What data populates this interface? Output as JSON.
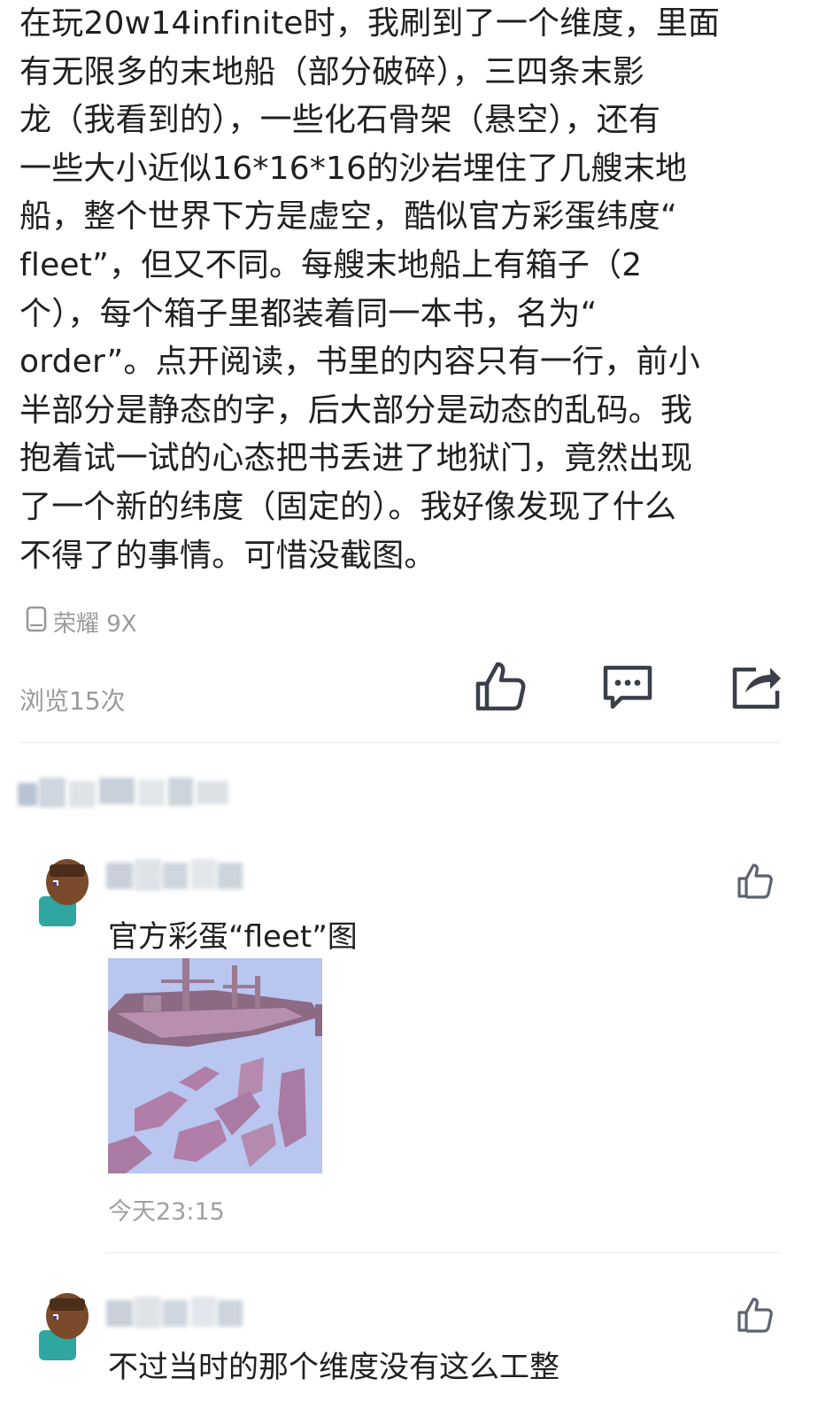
{
  "post": {
    "body": "在玩20w14infinite时，我刷到了一个维度，里面\n有无限多的末地船（部分破碎），三四条末影\n龙（我看到的），一些化石骨架（悬空），还有\n一些大小近似16*16*16的沙岩埋住了几艘末地\n船，整个世界下方是虚空，酷似官方彩蛋纬度“\nfleet”，但又不同。每艘末地船上有箱子（2\n个），每个箱子里都装着同一本书，名为“\norder”。点开阅读，书里的内容只有一行，前小\n半部分是静态的字，后大部分是动态的乱码。我\n抱着试一试的心态把书丢进了地狱门，竟然出现\n了一个新的纬度（固定的）。我好像发现了什么\n不得了的事情。可惜没截图。",
    "device": "荣耀 9X",
    "views": "浏览15次"
  },
  "actions": {
    "like_icon": "thumbs-up-icon",
    "comment_icon": "comment-bubble-icon",
    "share_icon": "share-icon"
  },
  "comments": [
    {
      "text": "官方彩蛋“fleet”图",
      "time": "今天23:15",
      "has_image": true
    },
    {
      "text": "不过当时的那个维度没有这么工整",
      "time": "",
      "has_image": false
    }
  ],
  "colors": {
    "text": "#202020",
    "muted": "#9a9a9a",
    "icon": "#3a3f4a",
    "divider": "#ececec"
  }
}
